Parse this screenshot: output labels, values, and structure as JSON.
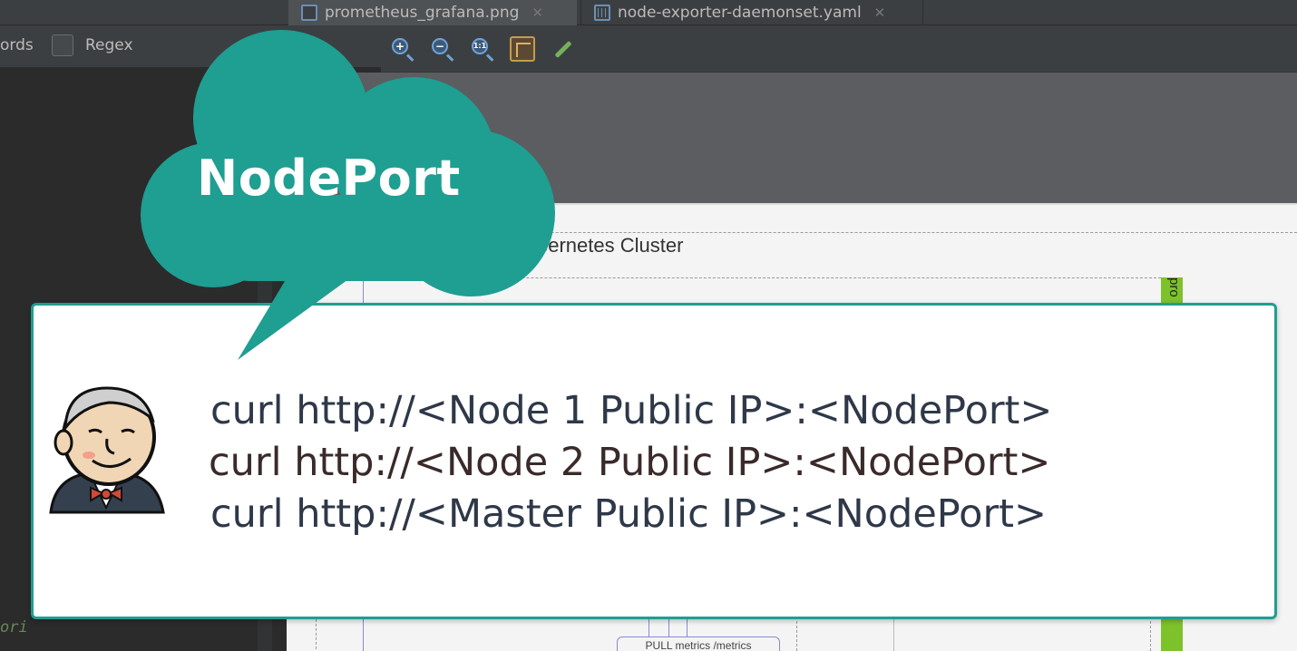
{
  "tabs": [
    {
      "label": "prometheus_grafana.png",
      "icon": "image-file-icon"
    },
    {
      "label": "node-exporter-daemonset.yaml",
      "icon": "yaml-file-icon"
    }
  ],
  "find_bar": {
    "words_fragment": "ords",
    "regex_label": "Regex",
    "regex_checked": false
  },
  "image_toolbar": {
    "tools": [
      "zoom-in-icon",
      "zoom-out-icon",
      "actual-size-icon",
      "grid-icon",
      "color-picker-icon"
    ],
    "actual_size_glyph": "1:1"
  },
  "editor": {
    "code_fragment": "ori"
  },
  "diagram": {
    "cluster_label": "bernetes Cluster",
    "green_label": "pro",
    "pull_label": "PULL metrics /metrics"
  },
  "overlay": {
    "title": "NodePort",
    "accent_color": "#1f9e92",
    "commands": [
      "curl http://<Node 1 Public IP>:<NodePort>",
      "curl http://<Node 2 Public IP>:<NodePort>",
      "curl http://<Master Public IP>:<NodePort>"
    ],
    "mascot": "jenkins-mascot-icon"
  }
}
